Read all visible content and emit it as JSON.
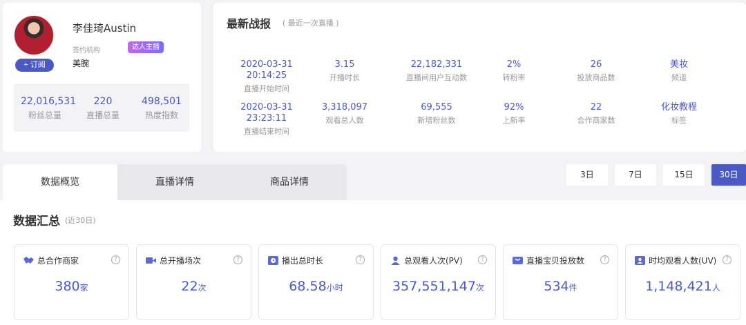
{
  "profile": {
    "name": "李佳琦Austin",
    "subscribe_label": "+ 订阅",
    "org_label": "签约机构",
    "badge": "达人主播",
    "org_value": "美腕",
    "stats": [
      {
        "value": "22,016,531",
        "label": "粉丝总量"
      },
      {
        "value": "220",
        "label": "直播总量"
      },
      {
        "value": "498,501",
        "label": "热度指数"
      }
    ]
  },
  "report": {
    "title": "最新战报",
    "subtitle": "( 最近一次直播 )",
    "row1": [
      {
        "value": "2020-03-31\n20:14:25",
        "label": "直播开始时间"
      },
      {
        "value": "3.15",
        "label": "开播时长"
      },
      {
        "value": "22,182,331",
        "label": "直播间用户互动数"
      },
      {
        "value": "2%",
        "label": "转粉率"
      },
      {
        "value": "26",
        "label": "投放商品数"
      },
      {
        "value": "美妆",
        "label": "频道"
      }
    ],
    "row2": [
      {
        "value": "2020-03-31\n23:23:11",
        "label": "直播结束时间"
      },
      {
        "value": "3,318,097",
        "label": "观看总人数"
      },
      {
        "value": "69,555",
        "label": "新增粉丝数"
      },
      {
        "value": "92%",
        "label": "上新率"
      },
      {
        "value": "22",
        "label": "合作商家数"
      },
      {
        "value": "化妆教程",
        "label": "标签"
      }
    ]
  },
  "tabs": [
    "数据概览",
    "直播详情",
    "商品详情"
  ],
  "ranges": [
    "3日",
    "7日",
    "15日",
    "30日"
  ],
  "summary": {
    "title": "数据汇总",
    "subtitle": "(近30日)",
    "metrics": [
      {
        "label": "总合作商家",
        "value": "380",
        "unit": "家",
        "icon": "handshake-icon"
      },
      {
        "label": "总开播场次",
        "value": "22",
        "unit": "次",
        "icon": "video-icon"
      },
      {
        "label": "播出总时长",
        "value": "68.58",
        "unit": "小时",
        "icon": "clock-icon"
      },
      {
        "label": "总观看人次(PV)",
        "value": "357,551,147",
        "unit": "次",
        "icon": "viewer-icon"
      },
      {
        "label": "直播宝贝投放数",
        "value": "534",
        "unit": "件",
        "icon": "basket-icon"
      },
      {
        "label": "时均观看人数(UV)",
        "value": "1,148,421",
        "unit": "人",
        "icon": "user-card-icon"
      }
    ]
  },
  "colors": {
    "accent": "#4a59c4",
    "badge_start": "#c266f2",
    "badge_end": "#7d6cf5"
  }
}
